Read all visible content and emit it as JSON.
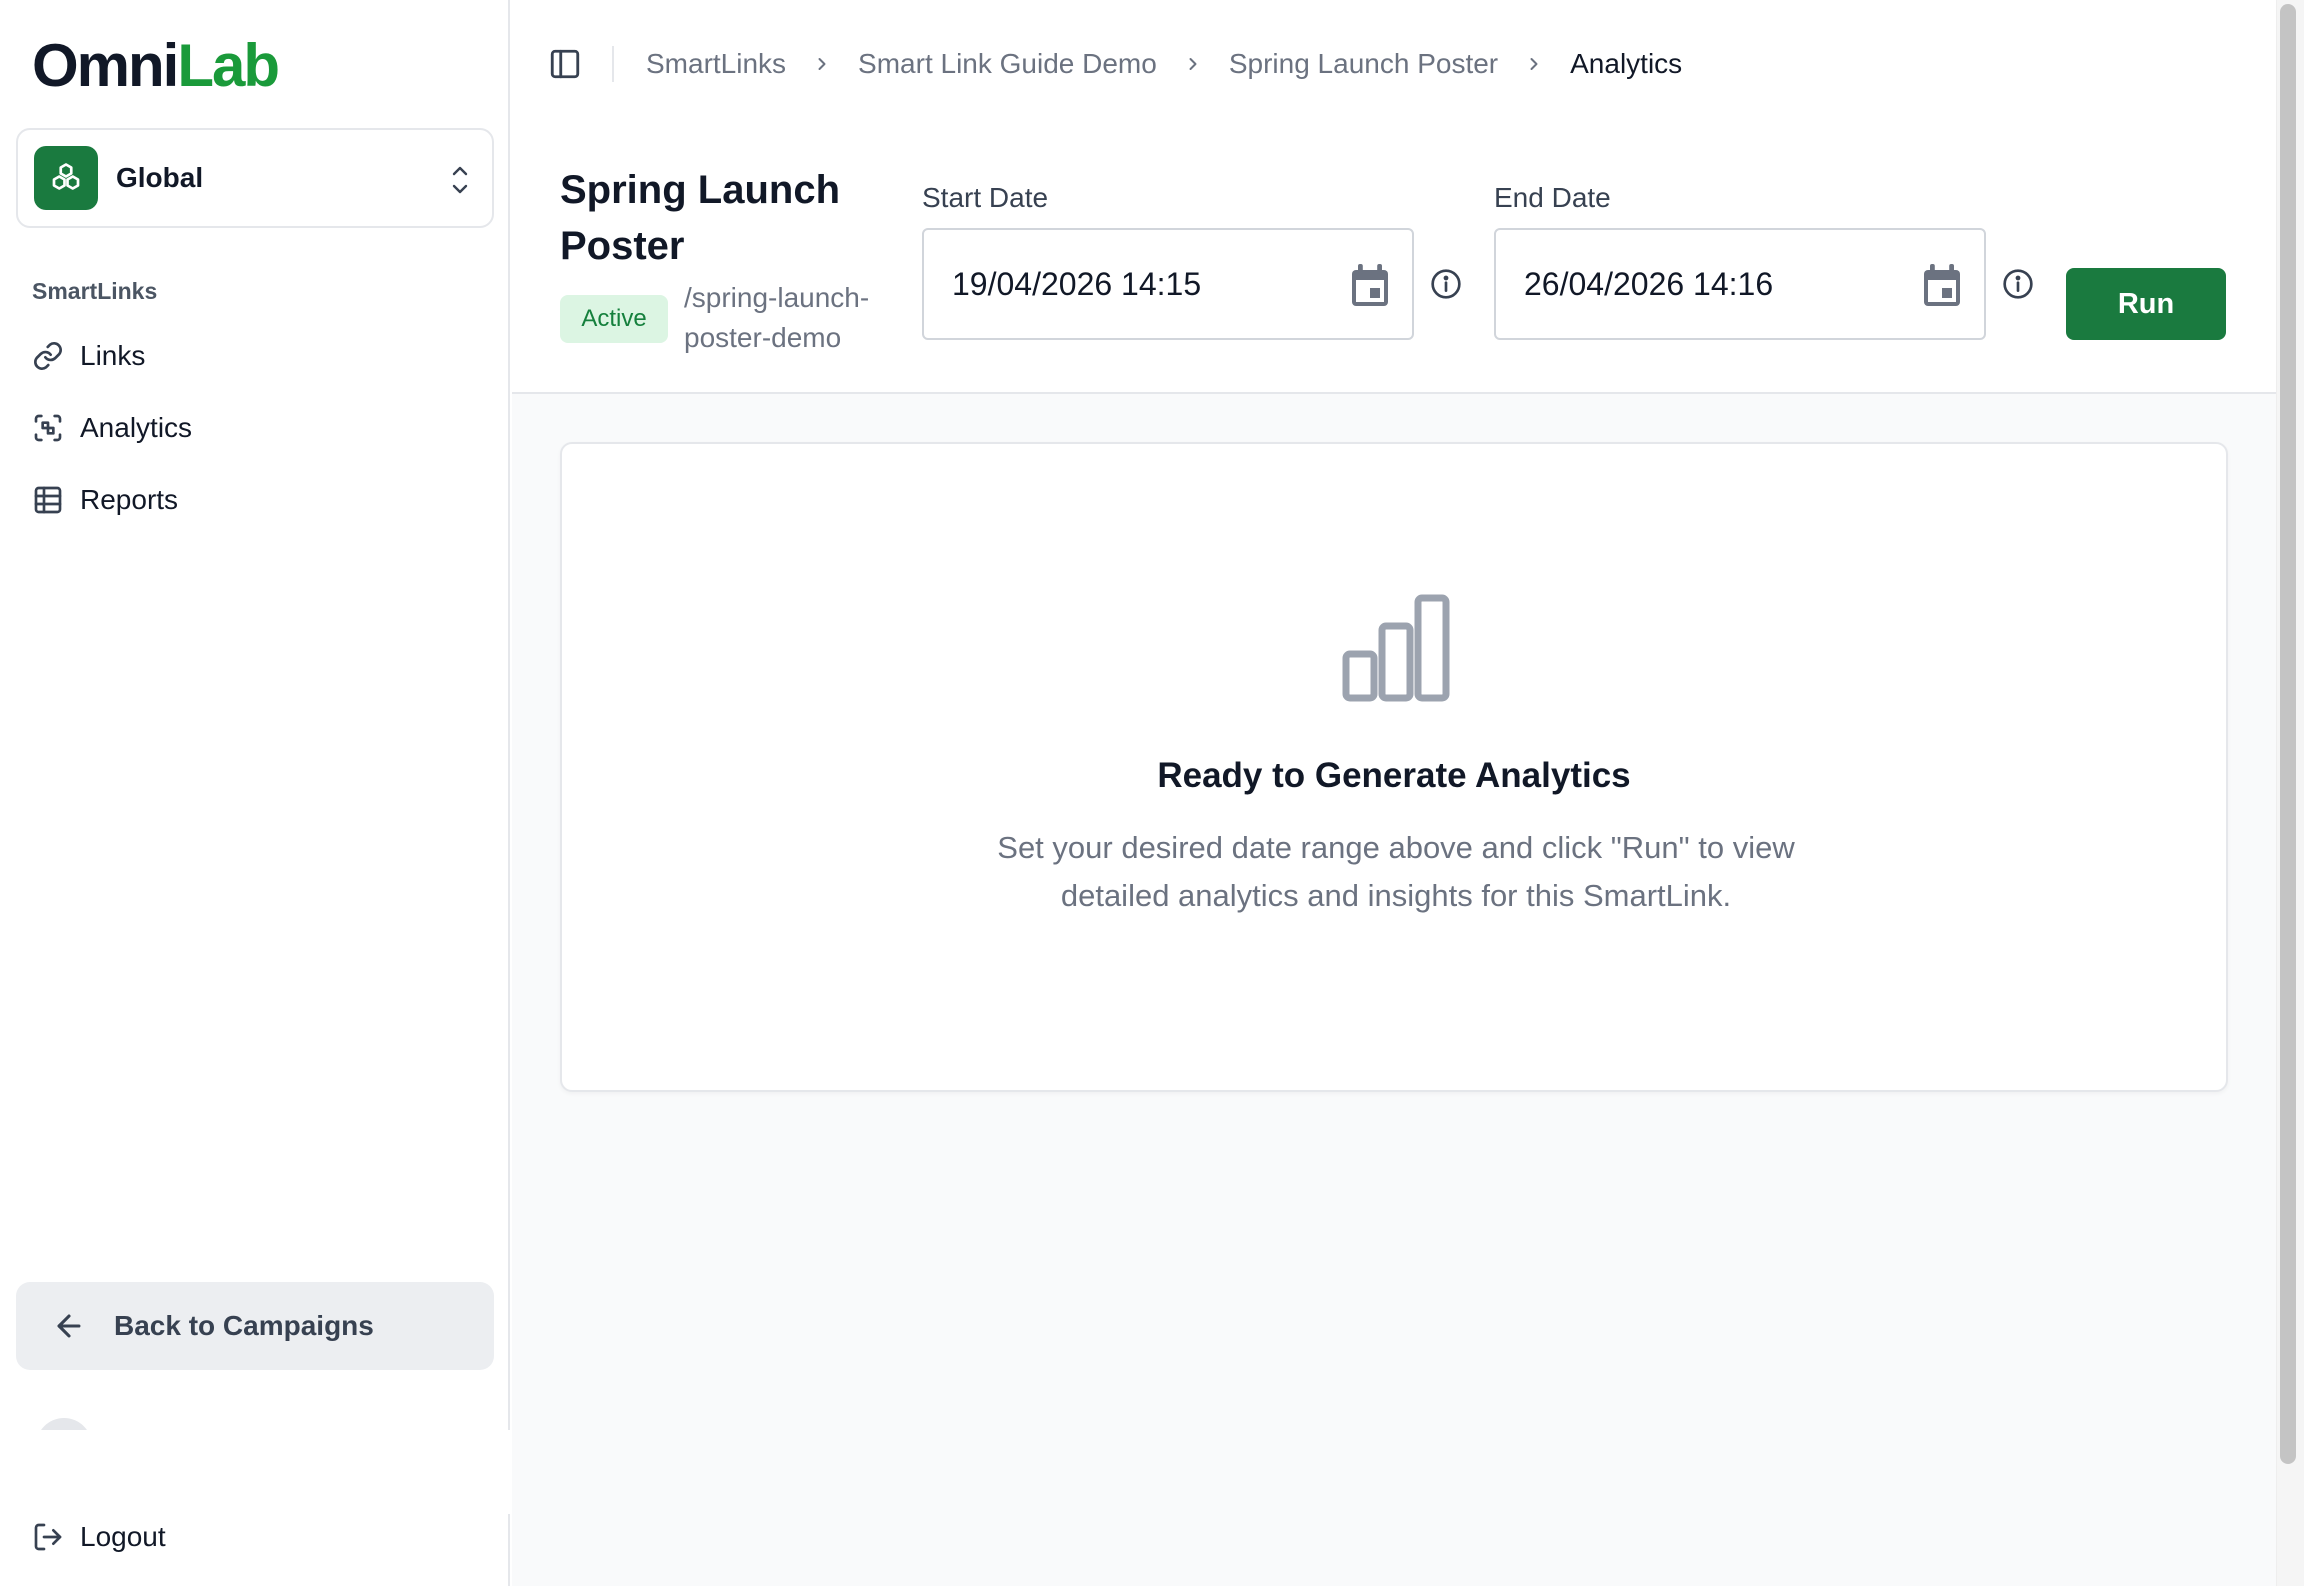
{
  "app": {
    "logo_part1": "Omni",
    "logo_part2": "Lab",
    "brand_green": "#1a9a3a",
    "accent_green": "#1a7a3f"
  },
  "sidebar": {
    "workspace": {
      "label": "Global",
      "icon": "workspace-icon"
    },
    "section_label": "SmartLinks",
    "items": [
      {
        "label": "Links",
        "icon": "link-icon"
      },
      {
        "label": "Analytics",
        "icon": "scan-icon"
      },
      {
        "label": "Reports",
        "icon": "table-icon"
      }
    ],
    "back_label": "Back to Campaigns",
    "logout_label": "Logout"
  },
  "breadcrumb": [
    {
      "label": "SmartLinks"
    },
    {
      "label": "Smart Link Guide Demo"
    },
    {
      "label": "Spring Launch Poster"
    },
    {
      "label": "Analytics"
    }
  ],
  "header": {
    "title": "Spring Launch Poster",
    "status": "Active",
    "slug": "/spring-launch-poster-demo",
    "start_label": "Start Date",
    "start_value": "19/04/2026 14:15",
    "end_label": "End Date",
    "end_value": "26/04/2026 14:16",
    "run_label": "Run"
  },
  "empty_state": {
    "icon": "bar-chart-icon",
    "title": "Ready to Generate Analytics",
    "description": "Set your desired date range above and click \"Run\" to view detailed analytics and insights for this SmartLink."
  }
}
